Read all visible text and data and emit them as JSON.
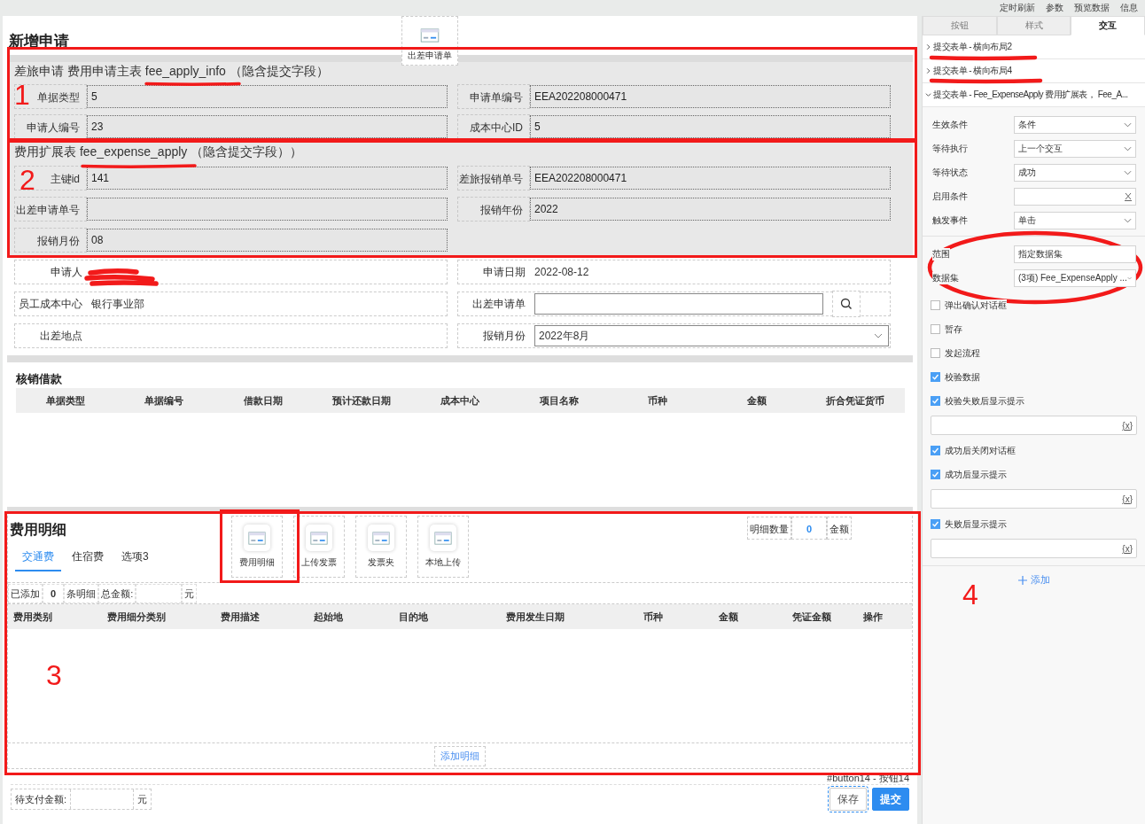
{
  "top_bar": {
    "links": [
      "定时刷新",
      "参数",
      "预览数据",
      "信息"
    ]
  },
  "form": {
    "title": "新增申请",
    "floating_button": {
      "label": "出差申请单"
    },
    "sections": [
      {
        "heading": "差旅申请 费用申请主表 fee_apply_info （隐含提交字段）",
        "fields": [
          {
            "label": "单据类型",
            "value": "5"
          },
          {
            "label": "申请单编号",
            "value": "EEA202208000471"
          },
          {
            "label": "申请人编号",
            "value": "23"
          },
          {
            "label": "成本中心ID",
            "value": "5"
          }
        ]
      },
      {
        "heading": "费用扩展表 fee_expense_apply （隐含提交字段））",
        "fields": [
          {
            "label": "主键id",
            "value": "141"
          },
          {
            "label": "差旅报销单号",
            "value": "EEA202208000471"
          },
          {
            "label": "出差申请单号"
          },
          {
            "label": "报销年份",
            "value": "2022"
          },
          {
            "label": "报销月份",
            "value": "08"
          }
        ]
      }
    ],
    "details": [
      {
        "kind": "redacted",
        "label": "申请人"
      },
      {
        "kind": "text",
        "label": "申请日期",
        "value": "2022-08-12"
      },
      {
        "kind": "text",
        "label": "员工成本中心",
        "value": "银行事业部"
      },
      {
        "kind": "lookup",
        "label": "出差申请单"
      },
      {
        "kind": "text",
        "label": "出差地点"
      },
      {
        "kind": "select",
        "label": "报销月份",
        "value": "2022年8月"
      }
    ]
  },
  "loans": {
    "title": "核销借款",
    "columns": [
      "单据类型",
      "单据编号",
      "借款日期",
      "预计还款日期",
      "成本中心",
      "项目名称",
      "币种",
      "金额",
      "折合凭证货币"
    ]
  },
  "expenses": {
    "title": "费用明细",
    "buttons": [
      {
        "label": "费用明细"
      },
      {
        "label": "上传发票"
      },
      {
        "label": "发票夹"
      },
      {
        "label": "本地上传"
      }
    ],
    "count_label": "明细数量",
    "count": "0",
    "amount_label": "金额",
    "tabs": [
      {
        "label": "交通费",
        "selected": true
      },
      {
        "label": "住宿费",
        "selected": false
      },
      {
        "label": "选项3",
        "selected": false
      }
    ],
    "added_label": "已添加",
    "added_count": "0",
    "items_label": "条明细",
    "total_label": "总金额:",
    "currency": "元",
    "columns": [
      "费用类别",
      "费用细分类别",
      "费用描述",
      "起始地",
      "目的地",
      "费用发生日期",
      "币种",
      "金额",
      "凭证金额",
      "操作"
    ],
    "add_button": "添加明细"
  },
  "footer": {
    "component_label": "#button14 - 按钮14",
    "pending_label": "待支付金额:",
    "currency": "元",
    "buttons": [
      {
        "label": "保存",
        "kind": "secondary",
        "selected": true
      },
      {
        "label": "提交",
        "kind": "primary",
        "selected": false
      }
    ]
  },
  "panel": {
    "tabs": [
      {
        "label": "按钮",
        "selected": false
      },
      {
        "label": "样式",
        "selected": false
      },
      {
        "label": "交互",
        "selected": true
      }
    ],
    "actions": [
      {
        "label": "提交表单 - 横向布局2",
        "expanded": false
      },
      {
        "label": "提交表单 - 横向布局4",
        "expanded": false
      },
      {
        "label": "提交表单 - Fee_ExpenseApply 费用扩展表， Fee_A...",
        "expanded": true
      }
    ],
    "settings": [
      {
        "kind": "select",
        "label": "生效条件",
        "value": "条件"
      },
      {
        "kind": "select",
        "label": "等待执行",
        "value": "上一个交互"
      },
      {
        "kind": "select",
        "label": "等待状态",
        "value": "成功"
      },
      {
        "kind": "clearable",
        "label": "启用条件"
      },
      {
        "kind": "select",
        "label": "触发事件",
        "value": "单击"
      }
    ],
    "scope": [
      {
        "kind": "plain",
        "label": "范围",
        "value": "指定数据集"
      },
      {
        "kind": "select",
        "label": "数据集",
        "value": "(3项) Fee_ExpenseApply ..."
      }
    ],
    "options": [
      {
        "kind": "checkbox",
        "label": "弹出确认对话框",
        "checked": false
      },
      {
        "kind": "checkbox",
        "label": "暂存",
        "checked": false
      },
      {
        "kind": "checkbox",
        "label": "发起流程",
        "checked": false
      },
      {
        "kind": "checkbox",
        "label": "校验数据",
        "checked": true
      },
      {
        "kind": "checkbox",
        "label": "校验失败后显示提示",
        "checked": true
      },
      {
        "kind": "field",
        "icon": "{x}"
      },
      {
        "kind": "checkbox",
        "label": "成功后关闭对话框",
        "checked": true
      },
      {
        "kind": "checkbox",
        "label": "成功后显示提示",
        "checked": true
      },
      {
        "kind": "field",
        "icon": "{x}"
      },
      {
        "kind": "checkbox",
        "label": "失败后显示提示",
        "checked": true
      },
      {
        "kind": "field",
        "icon": "{x}"
      }
    ],
    "add_button": "添加"
  },
  "markup": {
    "numbers": [
      "1",
      "2",
      "3",
      "4"
    ]
  }
}
